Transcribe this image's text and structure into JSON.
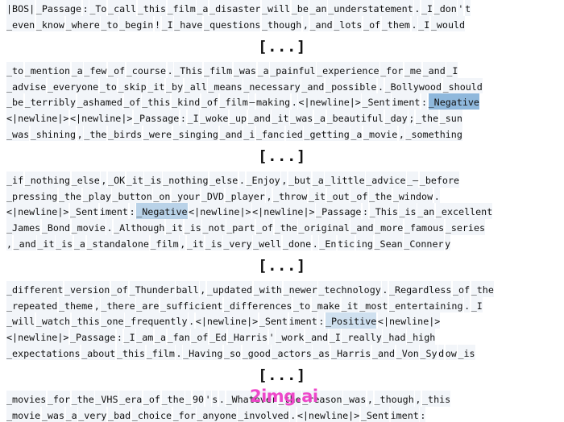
{
  "meta": {
    "background_color": "#ffffff",
    "text_color": "#111111",
    "token_background": "#f2f5f9",
    "highlight_strong": "#8fb8dc",
    "highlight_medium": "#b9d2e8",
    "highlight_light": "#cfe0ef",
    "watermark_color": "#ee3fc8"
  },
  "watermark": {
    "text": "2img.ai"
  },
  "separator": {
    "label": "[...]"
  },
  "blocks": [
    {
      "id": "block-1",
      "lines": [
        {
          "id": "line-1",
          "tokens": [
            {
              "t": "|BOS|"
            },
            {
              "t": "_Passage"
            },
            {
              "t": ":"
            },
            {
              "t": "_To"
            },
            {
              "t": "_call"
            },
            {
              "t": "_this"
            },
            {
              "t": "_film"
            },
            {
              "t": "_a"
            },
            {
              "t": "_disaster"
            },
            {
              "t": "_will"
            },
            {
              "t": "_be"
            },
            {
              "t": "_an"
            },
            {
              "t": "_understatement"
            },
            {
              "t": "."
            },
            {
              "t": "_I"
            },
            {
              "t": "_don"
            },
            {
              "t": "'"
            },
            {
              "t": "t"
            }
          ]
        },
        {
          "id": "line-2",
          "tokens": [
            {
              "t": "_even"
            },
            {
              "t": "_know"
            },
            {
              "t": "_where"
            },
            {
              "t": "_to"
            },
            {
              "t": "_begin"
            },
            {
              "t": "!"
            },
            {
              "t": "_I"
            },
            {
              "t": "_have"
            },
            {
              "t": "_questions"
            },
            {
              "t": "_though"
            },
            {
              "t": ","
            },
            {
              "t": "_and"
            },
            {
              "t": "_lots"
            },
            {
              "t": "_of"
            },
            {
              "t": "_them"
            },
            {
              "t": "."
            },
            {
              "t": "_I"
            },
            {
              "t": "_would"
            }
          ]
        }
      ]
    },
    {
      "id": "block-2",
      "lines": [
        {
          "id": "line-3",
          "tokens": [
            {
              "t": "_to"
            },
            {
              "t": "_mention"
            },
            {
              "t": "_a"
            },
            {
              "t": "_few"
            },
            {
              "t": "_of"
            },
            {
              "t": "_course"
            },
            {
              "t": "."
            },
            {
              "t": "_This"
            },
            {
              "t": "_film"
            },
            {
              "t": "_was"
            },
            {
              "t": "_a"
            },
            {
              "t": "_painful"
            },
            {
              "t": "_experience"
            },
            {
              "t": "_for"
            },
            {
              "t": "_me"
            },
            {
              "t": "_and"
            },
            {
              "t": "_I"
            }
          ]
        },
        {
          "id": "line-4",
          "tokens": [
            {
              "t": "_advise"
            },
            {
              "t": "_everyone"
            },
            {
              "t": "_to"
            },
            {
              "t": "_skip"
            },
            {
              "t": "_it"
            },
            {
              "t": "_by"
            },
            {
              "t": "_all"
            },
            {
              "t": "_means"
            },
            {
              "t": "_necessary"
            },
            {
              "t": "_and"
            },
            {
              "t": "_possible"
            },
            {
              "t": "."
            },
            {
              "t": "_Bollywood"
            },
            {
              "t": "_should"
            }
          ]
        },
        {
          "id": "line-5",
          "tokens": [
            {
              "t": "_be"
            },
            {
              "t": "_terribly"
            },
            {
              "t": "_ashamed"
            },
            {
              "t": "_of"
            },
            {
              "t": "_this"
            },
            {
              "t": "_kind"
            },
            {
              "t": "_of"
            },
            {
              "t": "_film"
            },
            {
              "t": "–"
            },
            {
              "t": "making"
            },
            {
              "t": "."
            },
            {
              "t": "<|newline|>"
            },
            {
              "t": "_Sent"
            },
            {
              "t": "iment"
            },
            {
              "t": ":"
            },
            {
              "t": "_Negative",
              "hl": "hl1"
            }
          ]
        },
        {
          "id": "line-6",
          "tokens": [
            {
              "t": "<|newline|>"
            },
            {
              "t": "<|newline|>"
            },
            {
              "t": "_Passage"
            },
            {
              "t": ":"
            },
            {
              "t": "_I"
            },
            {
              "t": "_woke"
            },
            {
              "t": "_up"
            },
            {
              "t": "_and"
            },
            {
              "t": "_it"
            },
            {
              "t": "_was"
            },
            {
              "t": "_a"
            },
            {
              "t": "_beautiful"
            },
            {
              "t": "_day"
            },
            {
              "t": ";"
            },
            {
              "t": "_the"
            },
            {
              "t": "_sun"
            }
          ]
        },
        {
          "id": "line-7",
          "tokens": [
            {
              "t": "_was"
            },
            {
              "t": "_shining"
            },
            {
              "t": ","
            },
            {
              "t": "_the"
            },
            {
              "t": "_birds"
            },
            {
              "t": "_were"
            },
            {
              "t": "_singing"
            },
            {
              "t": "_and"
            },
            {
              "t": "_i"
            },
            {
              "t": "_fanc"
            },
            {
              "t": "ied"
            },
            {
              "t": "_getting"
            },
            {
              "t": "_a"
            },
            {
              "t": "_movie"
            },
            {
              "t": ","
            },
            {
              "t": "_something"
            }
          ]
        }
      ]
    },
    {
      "id": "block-3",
      "lines": [
        {
          "id": "line-8",
          "tokens": [
            {
              "t": "_if"
            },
            {
              "t": "_nothing"
            },
            {
              "t": "_else"
            },
            {
              "t": ","
            },
            {
              "t": "_OK"
            },
            {
              "t": "_it"
            },
            {
              "t": "_is"
            },
            {
              "t": "_nothing"
            },
            {
              "t": "_else"
            },
            {
              "t": "."
            },
            {
              "t": "_Enjoy"
            },
            {
              "t": ","
            },
            {
              "t": "_but"
            },
            {
              "t": "_a"
            },
            {
              "t": "_little"
            },
            {
              "t": "_advice"
            },
            {
              "t": "_–"
            },
            {
              "t": "_before"
            }
          ]
        },
        {
          "id": "line-9",
          "tokens": [
            {
              "t": "_pressing"
            },
            {
              "t": "_the"
            },
            {
              "t": "_play"
            },
            {
              "t": "_button"
            },
            {
              "t": "_on"
            },
            {
              "t": "_your"
            },
            {
              "t": "_DVD"
            },
            {
              "t": "_player"
            },
            {
              "t": ","
            },
            {
              "t": "_throw"
            },
            {
              "t": "_it"
            },
            {
              "t": "_out"
            },
            {
              "t": "_of"
            },
            {
              "t": "_the"
            },
            {
              "t": "_window"
            },
            {
              "t": "."
            }
          ]
        },
        {
          "id": "line-10",
          "tokens": [
            {
              "t": "<|newline|>"
            },
            {
              "t": "_Sent"
            },
            {
              "t": "iment"
            },
            {
              "t": ":"
            },
            {
              "t": "_Negative",
              "hl": "hl2"
            },
            {
              "t": "<|newline|>"
            },
            {
              "t": "<|newline|>"
            },
            {
              "t": "_Passage"
            },
            {
              "t": ":"
            },
            {
              "t": "_This"
            },
            {
              "t": "_is"
            },
            {
              "t": "_an"
            },
            {
              "t": "_excellent"
            }
          ]
        },
        {
          "id": "line-11",
          "tokens": [
            {
              "t": "_James"
            },
            {
              "t": "_Bond"
            },
            {
              "t": "_movie"
            },
            {
              "t": "."
            },
            {
              "t": "_Although"
            },
            {
              "t": "_it"
            },
            {
              "t": "_is"
            },
            {
              "t": "_not"
            },
            {
              "t": "_part"
            },
            {
              "t": "_of"
            },
            {
              "t": "_the"
            },
            {
              "t": "_original"
            },
            {
              "t": "_and"
            },
            {
              "t": "_more"
            },
            {
              "t": "_famous"
            },
            {
              "t": "_series"
            }
          ]
        },
        {
          "id": "line-12",
          "tokens": [
            {
              "t": ","
            },
            {
              "t": "_and"
            },
            {
              "t": "_it"
            },
            {
              "t": "_is"
            },
            {
              "t": "_a"
            },
            {
              "t": "_standalone"
            },
            {
              "t": "_film"
            },
            {
              "t": ","
            },
            {
              "t": "_it"
            },
            {
              "t": "_is"
            },
            {
              "t": "_very"
            },
            {
              "t": "_well"
            },
            {
              "t": "_done"
            },
            {
              "t": "."
            },
            {
              "t": "_En"
            },
            {
              "t": "tic"
            },
            {
              "t": "ing"
            },
            {
              "t": "_Sean"
            },
            {
              "t": "_Conner"
            },
            {
              "t": "y"
            }
          ]
        }
      ]
    },
    {
      "id": "block-4",
      "lines": [
        {
          "id": "line-13",
          "tokens": [
            {
              "t": "_different"
            },
            {
              "t": "_version"
            },
            {
              "t": "_of"
            },
            {
              "t": "_Thunder"
            },
            {
              "t": "ball"
            },
            {
              "t": ","
            },
            {
              "t": "_updated"
            },
            {
              "t": "_with"
            },
            {
              "t": "_newer"
            },
            {
              "t": "_technology"
            },
            {
              "t": "."
            },
            {
              "t": "_Regardless"
            },
            {
              "t": "_of"
            },
            {
              "t": "_the"
            }
          ]
        },
        {
          "id": "line-14",
          "tokens": [
            {
              "t": "_repeated"
            },
            {
              "t": "_theme"
            },
            {
              "t": ","
            },
            {
              "t": "_there"
            },
            {
              "t": "_are"
            },
            {
              "t": "_sufficient"
            },
            {
              "t": "_differences"
            },
            {
              "t": "_to"
            },
            {
              "t": "_make"
            },
            {
              "t": "_it"
            },
            {
              "t": "_most"
            },
            {
              "t": "_entertaining"
            },
            {
              "t": "."
            },
            {
              "t": "_I"
            }
          ]
        },
        {
          "id": "line-15",
          "tokens": [
            {
              "t": "_will"
            },
            {
              "t": "_watch"
            },
            {
              "t": "_this"
            },
            {
              "t": "_one"
            },
            {
              "t": "_frequently"
            },
            {
              "t": "."
            },
            {
              "t": "<|newline|>"
            },
            {
              "t": "_Sent"
            },
            {
              "t": "iment"
            },
            {
              "t": ":"
            },
            {
              "t": "_Positive",
              "hl": "hl3"
            },
            {
              "t": "<|newline|>"
            }
          ]
        },
        {
          "id": "line-16",
          "tokens": [
            {
              "t": "<|newline|>"
            },
            {
              "t": "_Passage"
            },
            {
              "t": ":"
            },
            {
              "t": "_I"
            },
            {
              "t": "_am"
            },
            {
              "t": "_a"
            },
            {
              "t": "_fan"
            },
            {
              "t": "_of"
            },
            {
              "t": "_Ed"
            },
            {
              "t": "_Harris"
            },
            {
              "t": "'"
            },
            {
              "t": "_work"
            },
            {
              "t": "_and"
            },
            {
              "t": "_I"
            },
            {
              "t": "_really"
            },
            {
              "t": "_had"
            },
            {
              "t": "_high"
            }
          ]
        },
        {
          "id": "line-17",
          "tokens": [
            {
              "t": "_expectations"
            },
            {
              "t": "_about"
            },
            {
              "t": "_this"
            },
            {
              "t": "_film"
            },
            {
              "t": "."
            },
            {
              "t": "_Having"
            },
            {
              "t": "_so"
            },
            {
              "t": "_good"
            },
            {
              "t": "_actors"
            },
            {
              "t": "_as"
            },
            {
              "t": "_Harris"
            },
            {
              "t": "_and"
            },
            {
              "t": "_Von"
            },
            {
              "t": "_Sy"
            },
            {
              "t": "d"
            },
            {
              "t": "ow"
            },
            {
              "t": "_is"
            }
          ]
        }
      ]
    },
    {
      "id": "block-5",
      "lines": [
        {
          "id": "line-18",
          "tokens": [
            {
              "t": "_movies"
            },
            {
              "t": "_for"
            },
            {
              "t": "_the"
            },
            {
              "t": "_VHS"
            },
            {
              "t": "_era"
            },
            {
              "t": "_of"
            },
            {
              "t": "_the"
            },
            {
              "t": "_"
            },
            {
              "t": "90"
            },
            {
              "t": "'"
            },
            {
              "t": "s"
            },
            {
              "t": "."
            },
            {
              "t": "_Whatever"
            },
            {
              "t": "_the"
            },
            {
              "t": "_reason"
            },
            {
              "t": "_was"
            },
            {
              "t": ","
            },
            {
              "t": "_though"
            },
            {
              "t": ","
            },
            {
              "t": "_this"
            }
          ]
        },
        {
          "id": "line-19",
          "tokens": [
            {
              "t": "_movie"
            },
            {
              "t": "_was"
            },
            {
              "t": "_a"
            },
            {
              "t": "_very"
            },
            {
              "t": "_bad"
            },
            {
              "t": "_choice"
            },
            {
              "t": "_for"
            },
            {
              "t": "_anyone"
            },
            {
              "t": "_involved"
            },
            {
              "t": "."
            },
            {
              "t": "<|newline|>"
            },
            {
              "t": "_Sent"
            },
            {
              "t": "iment"
            },
            {
              "t": ":"
            }
          ]
        }
      ]
    }
  ]
}
